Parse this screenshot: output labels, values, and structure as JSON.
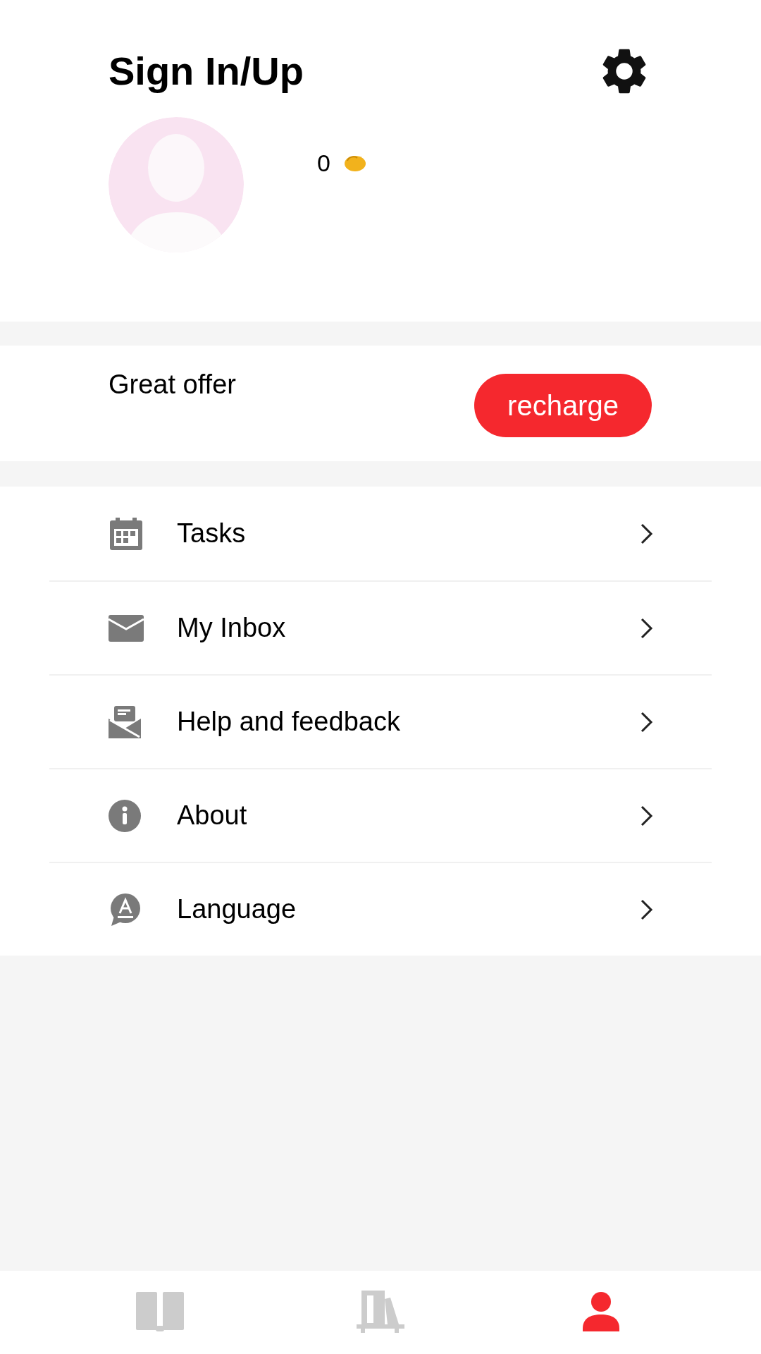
{
  "header": {
    "title": "Sign In/Up",
    "coins": "0"
  },
  "offer": {
    "text": "Great offer",
    "button": "recharge"
  },
  "menu": [
    {
      "kind": "calendar",
      "label": "Tasks"
    },
    {
      "kind": "mail",
      "label": "My Inbox"
    },
    {
      "kind": "feedback",
      "label": "Help and feedback"
    },
    {
      "kind": "info",
      "label": "About"
    },
    {
      "kind": "language",
      "label": "Language"
    }
  ],
  "tab_bar": [
    {
      "kind": "book",
      "selected": false
    },
    {
      "kind": "shelf",
      "selected": false
    },
    {
      "kind": "profile",
      "selected": true
    }
  ]
}
